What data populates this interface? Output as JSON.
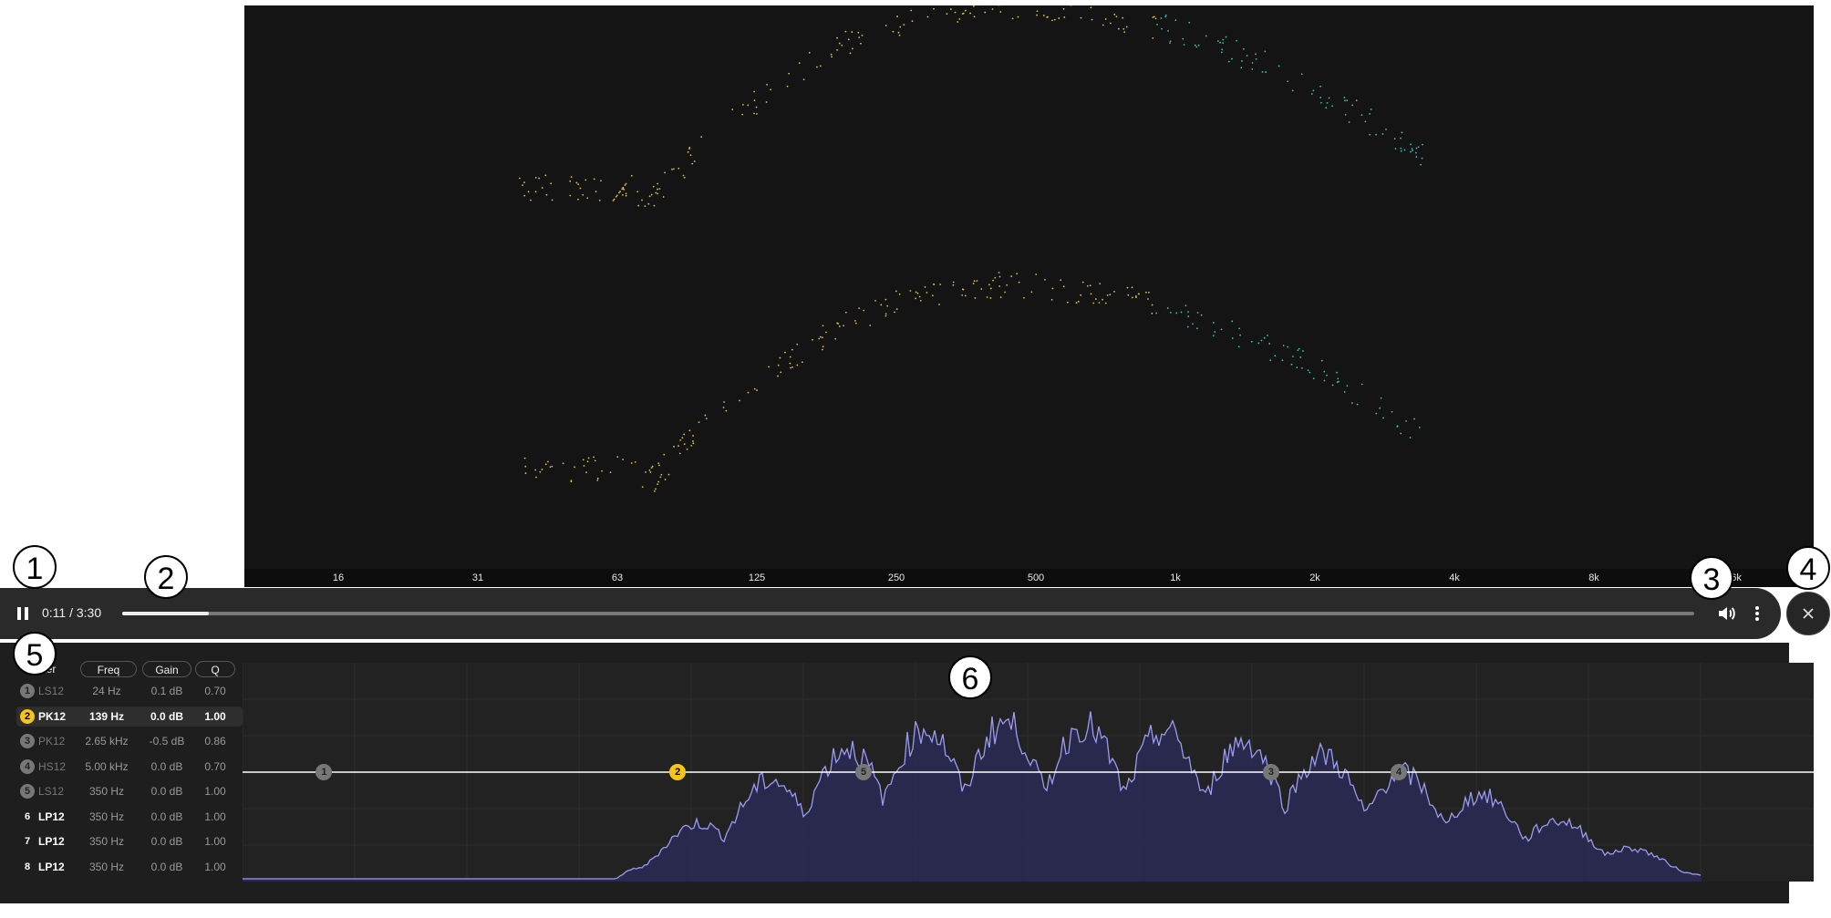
{
  "spectrum": {
    "frequency_ticks": [
      "16",
      "31",
      "63",
      "125",
      "250",
      "500",
      "1k",
      "2k",
      "4k",
      "8k",
      "16k"
    ]
  },
  "player": {
    "time": "0:11 / 3:30",
    "progress": 0.055,
    "state": "playing",
    "icons": {
      "play_pause": "pause-icon",
      "volume": "volume-icon",
      "more": "more-vertical-icon",
      "close": "close-icon"
    }
  },
  "eq": {
    "headers": {
      "filter": "Filter",
      "freq": "Freq",
      "gain": "Gain",
      "q": "Q"
    },
    "filters": [
      {
        "num": "1",
        "type": "LS12",
        "freq": "24 Hz",
        "gain": "0.1 dB",
        "q": "0.70",
        "enabled": false,
        "active": false
      },
      {
        "num": "2",
        "type": "PK12",
        "freq": "139 Hz",
        "gain": "0.0 dB",
        "q": "1.00",
        "enabled": true,
        "active": true
      },
      {
        "num": "3",
        "type": "PK12",
        "freq": "2.65 kHz",
        "gain": "-0.5 dB",
        "q": "0.86",
        "enabled": false,
        "active": false
      },
      {
        "num": "4",
        "type": "HS12",
        "freq": "5.00 kHz",
        "gain": "0.0 dB",
        "q": "0.70",
        "enabled": false,
        "active": false
      },
      {
        "num": "5",
        "type": "LS12",
        "freq": "350 Hz",
        "gain": "0.0 dB",
        "q": "1.00",
        "enabled": false,
        "active": false
      },
      {
        "num": "6",
        "type": "LP12",
        "freq": "350 Hz",
        "gain": "0.0 dB",
        "q": "1.00",
        "enabled": true,
        "active": false
      },
      {
        "num": "7",
        "type": "LP12",
        "freq": "350 Hz",
        "gain": "0.0 dB",
        "q": "1.00",
        "enabled": true,
        "active": false
      },
      {
        "num": "8",
        "type": "LP12",
        "freq": "350 Hz",
        "gain": "0.0 dB",
        "q": "1.00",
        "enabled": true,
        "active": false
      }
    ],
    "nodes": [
      {
        "label": "1",
        "freq_hz": 24,
        "color": "#777777"
      },
      {
        "label": "2",
        "freq_hz": 139,
        "color": "#f5c518"
      },
      {
        "label": "5",
        "freq_hz": 350,
        "color": "#777777"
      },
      {
        "label": "3",
        "freq_hz": 2650,
        "color": "#777777"
      },
      {
        "label": "4",
        "freq_hz": 5000,
        "color": "#777777"
      }
    ]
  },
  "callouts": [
    "1",
    "2",
    "3",
    "4",
    "5",
    "6"
  ],
  "colors": {
    "accent": "#f5c518",
    "curve": "#9b9bf0",
    "fill": "#2a2a55"
  }
}
